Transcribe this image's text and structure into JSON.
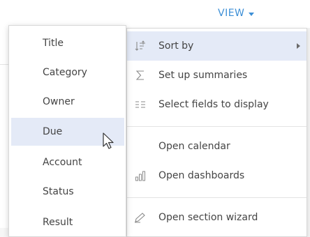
{
  "view_button": {
    "label": "VIEW",
    "color": "#3d8fd6"
  },
  "view_menu": {
    "items": [
      {
        "label": "Sort by",
        "icon": "sort-icon",
        "highlighted": true,
        "has_submenu": true
      },
      {
        "label": "Set up summaries",
        "icon": "sigma-icon"
      },
      {
        "label": "Select fields to display",
        "icon": "fields-list-icon"
      },
      {
        "label": "Open calendar",
        "icon": ""
      },
      {
        "label": "Open dashboards",
        "icon": "bar-chart-icon"
      },
      {
        "label": "Open section wizard",
        "icon": "pencil-icon"
      }
    ]
  },
  "sort_menu": {
    "items": [
      {
        "label": "Title"
      },
      {
        "label": "Category"
      },
      {
        "label": "Owner"
      },
      {
        "label": "Due",
        "highlighted": true
      },
      {
        "label": "Account"
      },
      {
        "label": "Status"
      },
      {
        "label": "Result"
      }
    ]
  },
  "colors": {
    "highlight": "#e4eaf7",
    "text": "#444444",
    "icon": "#8a8a8a"
  }
}
